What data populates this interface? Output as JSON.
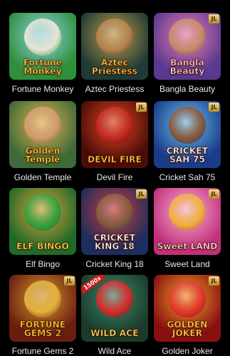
{
  "games": [
    {
      "title": "Fortune Monkey",
      "logo": "Fortune Monkey",
      "badge": "",
      "bg": "#2f8f3a",
      "bg2": "#8fd4e8",
      "figure": "#e9e4d8",
      "logo_color": "#ffd23a"
    },
    {
      "title": "Aztec Priestess",
      "logo": "Aztec Priestess",
      "badge": "",
      "bg": "#1e3b36",
      "bg2": "#c39b48",
      "figure": "#b9834a",
      "logo_color": "#ffcf4a"
    },
    {
      "title": "Bangla Beauty",
      "logo": "Bangla Beauty",
      "badge": "JL",
      "bg": "#5a3a8f",
      "bg2": "#f07ab0",
      "figure": "#c98a6a",
      "logo_color": "#ffd1f0"
    },
    {
      "title": "Golden Temple",
      "logo": "Golden Temple",
      "badge": "",
      "bg": "#3e6a3a",
      "bg2": "#e3b24a",
      "figure": "#d69a6a",
      "logo_color": "#ffdc3a"
    },
    {
      "title": "Devil Fire",
      "logo": "DEVIL FIRE",
      "badge": "JL",
      "bg": "#4a0d08",
      "bg2": "#e2451e",
      "figure": "#c42b1e",
      "logo_color": "#ffcf3a"
    },
    {
      "title": "Cricket Sah 75",
      "logo": "CRICKET SAH 75",
      "badge": "JL",
      "bg": "#1b3c8a",
      "bg2": "#6cc2f0",
      "figure": "#8a5a3a",
      "logo_color": "#ffffff"
    },
    {
      "title": "Elf Bingo",
      "logo": "ELF BINGO",
      "badge": "",
      "bg": "#1f6a2a",
      "bg2": "#e0a13a",
      "figure": "#3aa03a",
      "logo_color": "#ffe04a"
    },
    {
      "title": "Cricket King 18",
      "logo": "CRICKET KING 18",
      "badge": "JL",
      "bg": "#1d2d5e",
      "bg2": "#d23b3b",
      "figure": "#8a5a3a",
      "logo_color": "#ffffff"
    },
    {
      "title": "Sweet Land",
      "logo": "Sweet LAND",
      "badge": "JL",
      "bg": "#c2307a",
      "bg2": "#f7b3d8",
      "figure": "#f0b13a",
      "logo_color": "#ffe2f0"
    },
    {
      "title": "Fortune Gems 2",
      "logo": "FORTUNE GEMS 2",
      "badge": "JL",
      "bg": "#6a1e10",
      "bg2": "#d89a2a",
      "figure": "#e3b23a",
      "logo_color": "#ffd23a"
    },
    {
      "title": "Wild Ace",
      "logo": "WILD ACE",
      "badge": "",
      "ribbon": "1500x",
      "bg": "#1b3a2a",
      "bg2": "#3a8a6a",
      "figure": "#d42b2b",
      "logo_color": "#ffe066"
    },
    {
      "title": "Golden Joker",
      "logo": "GOLDEN JOKER",
      "badge": "JL",
      "bg": "#8a1010",
      "bg2": "#f0a12a",
      "figure": "#e23a2a",
      "logo_color": "#ffd84a"
    }
  ]
}
